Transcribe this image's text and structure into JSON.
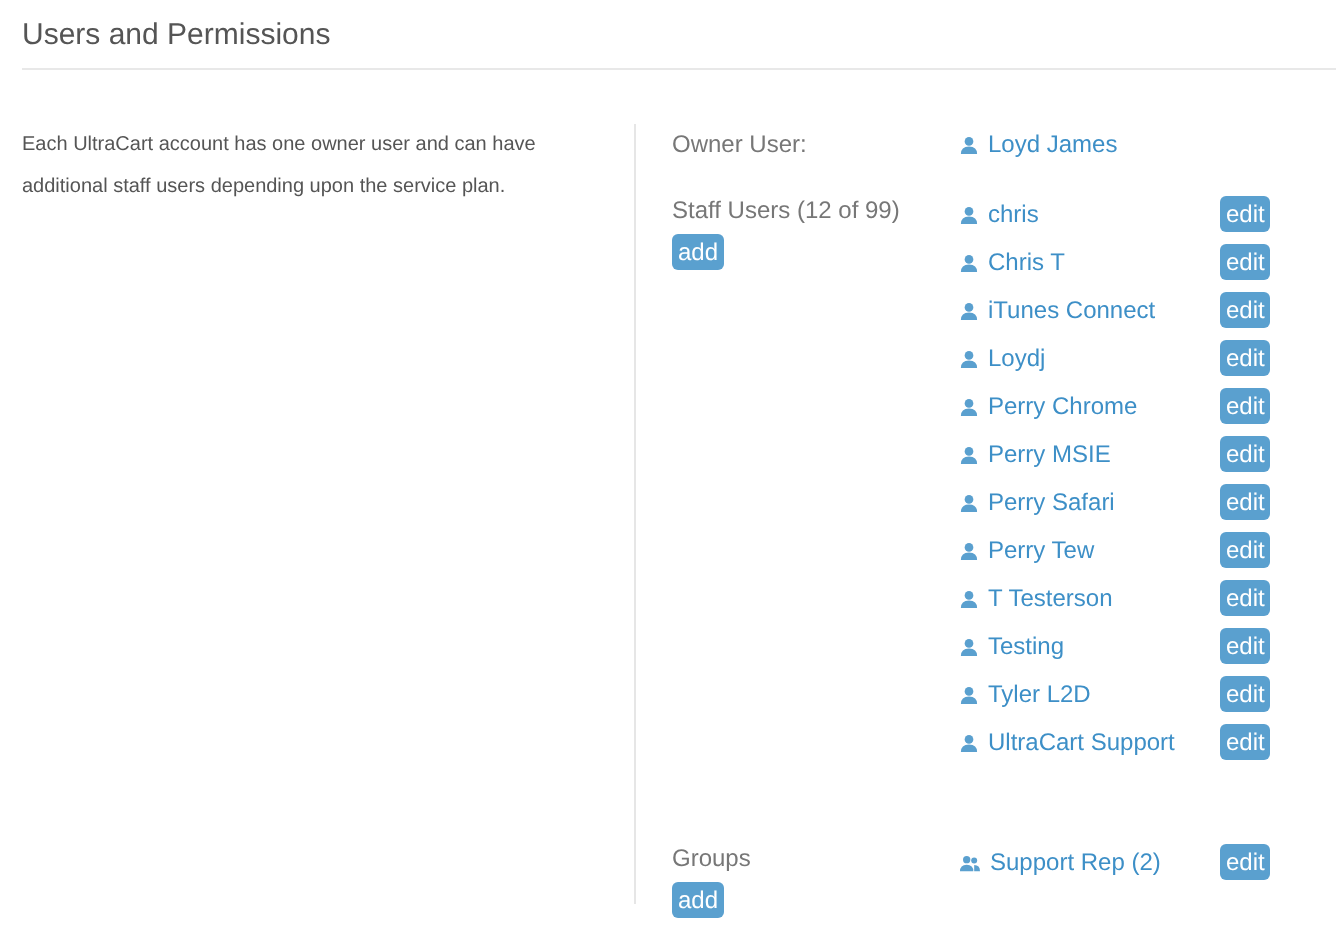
{
  "title": "Users and Permissions",
  "description": "Each UltraCart account has one owner user and can have additional staff users depending upon the service plan.",
  "owner": {
    "label": "Owner User:",
    "name": "Loyd James"
  },
  "staff": {
    "label": "Staff Users (12 of 99)",
    "add": "add",
    "users": [
      {
        "name": "chris",
        "action": "edit"
      },
      {
        "name": "Chris T",
        "action": "edit"
      },
      {
        "name": "iTunes Connect",
        "action": "edit"
      },
      {
        "name": "Loydj",
        "action": "edit"
      },
      {
        "name": "Perry Chrome",
        "action": "edit"
      },
      {
        "name": "Perry MSIE",
        "action": "edit"
      },
      {
        "name": "Perry Safari",
        "action": "edit"
      },
      {
        "name": "Perry Tew",
        "action": "edit"
      },
      {
        "name": "T Testerson",
        "action": "edit"
      },
      {
        "name": "Testing",
        "action": "edit"
      },
      {
        "name": "Tyler L2D",
        "action": "edit"
      },
      {
        "name": "UltraCart Support",
        "action": "edit"
      }
    ]
  },
  "groups": {
    "label": "Groups",
    "add": "add",
    "items": [
      {
        "name": "Support Rep (2)",
        "action": "edit"
      }
    ]
  }
}
